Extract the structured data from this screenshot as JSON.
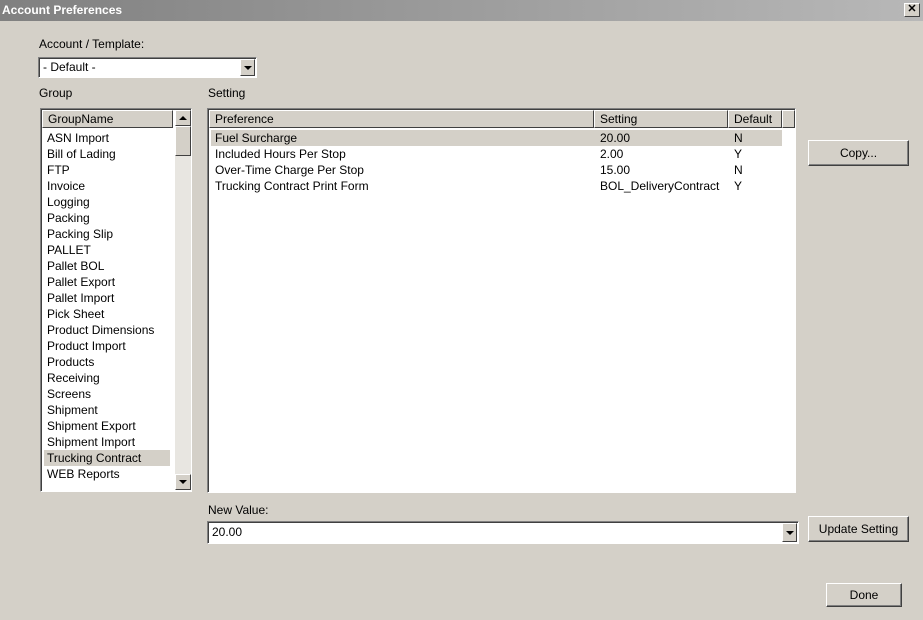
{
  "window": {
    "title": "Account Preferences",
    "close_glyph": "✕"
  },
  "account": {
    "label": "Account / Template:",
    "value": "- Default -"
  },
  "group": {
    "label": "Group",
    "column": "GroupName",
    "items": [
      "ASN Import",
      "Bill of Lading",
      "FTP",
      "Invoice",
      "Logging",
      "Packing",
      "Packing Slip",
      "PALLET",
      "Pallet BOL",
      "Pallet Export",
      "Pallet Import",
      "Pick Sheet",
      "Product Dimensions",
      "Product Import",
      "Products",
      "Receiving",
      "Screens",
      "Shipment",
      "Shipment Export",
      "Shipment Import",
      "Trucking Contract",
      "WEB Reports"
    ],
    "selected": "Trucking Contract"
  },
  "setting": {
    "label": "Setting",
    "columns": [
      "Preference",
      "Setting",
      "Default"
    ],
    "rows": [
      {
        "preference": "Fuel Surcharge",
        "setting": "20.00",
        "default": "N"
      },
      {
        "preference": "Included Hours Per Stop",
        "setting": "2.00",
        "default": "Y"
      },
      {
        "preference": "Over-Time Charge Per Stop",
        "setting": "15.00",
        "default": "N"
      },
      {
        "preference": "Trucking Contract Print Form",
        "setting": "BOL_DeliveryContract",
        "default": "Y"
      }
    ],
    "selected_row": 0
  },
  "new_value": {
    "label": "New Value:",
    "value": "20.00"
  },
  "buttons": {
    "copy": "Copy...",
    "update": "Update Setting",
    "done": "Done"
  }
}
